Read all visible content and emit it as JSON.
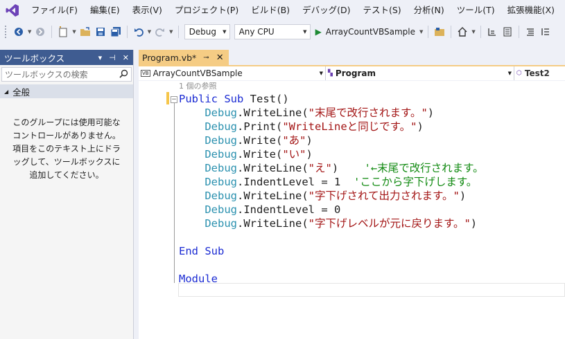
{
  "menu": {
    "items": [
      "ファイル(F)",
      "編集(E)",
      "表示(V)",
      "プロジェクト(P)",
      "ビルド(B)",
      "デバッグ(D)",
      "テスト(S)",
      "分析(N)",
      "ツール(T)",
      "拡張機能(X)"
    ]
  },
  "toolbar": {
    "configuration": "Debug",
    "platform": "Any CPU",
    "start_project": "ArrayCountVBSample"
  },
  "toolbox": {
    "title": "ツールボックス",
    "search_placeholder": "ツールボックスの検索",
    "group_label": "全般",
    "empty_message": "このグループには使用可能なコントロールがありません。項目をこのテキスト上にドラッグして、ツールボックスに追加してください。"
  },
  "editor": {
    "tab_label": "Program.vb*",
    "nav_project": "ArrayCountVBSample",
    "nav_class": "Program",
    "nav_member": "Test2",
    "reference_count": "1 個の参照",
    "code": {
      "l1_kw": "Public Sub",
      "l1_rest": " Test()",
      "obj": "Debug",
      "l2_method": ".WriteLine(",
      "l2_str": "\"末尾で改行されます。\"",
      "l3_method": ".Print(",
      "l3_str": "\"WriteLineと同じです。\"",
      "l4_method": ".Write(",
      "l4_str": "\"あ\"",
      "l5_str": "\"い\"",
      "l6_str": "\"え\"",
      "l6_comment": "'←末尾で改行されます。",
      "l7_method": ".IndentLevel = 1",
      "l7_comment": "'ここから字下げします。",
      "l8_str": "\"字下げされて出力されます。\"",
      "l9_method": ".IndentLevel = 0",
      "l10_str": "\"字下げレベルが元に戻ります。\"",
      "close_paren": ")",
      "end_sub": "End Sub",
      "module": "Module"
    }
  }
}
